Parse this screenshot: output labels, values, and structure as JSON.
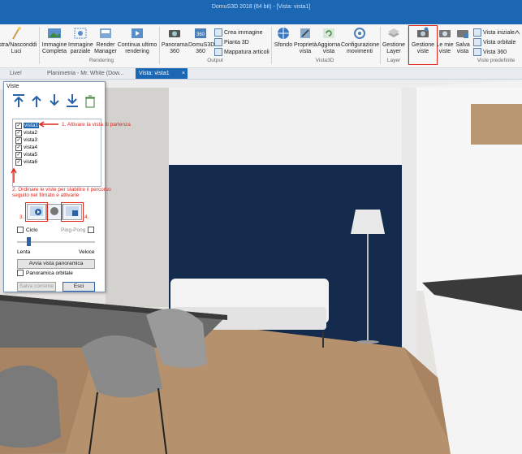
{
  "window": {
    "title": "DomuS3D 2018 (64 bit) - [Vista: vista1]"
  },
  "ribbon": {
    "buttons": [
      {
        "label": "ostra/Nasconddi\nLuci",
        "icon": "lights-icon"
      },
      {
        "label": "Immagine\nCompleta",
        "icon": "full-image-icon"
      },
      {
        "label": "Immagine\nparziale",
        "icon": "partial-image-icon"
      },
      {
        "label": "Render\nManager",
        "icon": "render-manager-icon"
      },
      {
        "label": "Continua ultimo\nrendering",
        "icon": "continue-render-icon"
      },
      {
        "label": "Panorama\n360",
        "icon": "panorama-icon"
      },
      {
        "label": "DomuS3D\n360",
        "icon": "domus-360-icon"
      },
      {
        "label": "Sfondo",
        "icon": "background-icon"
      },
      {
        "label": "Proprietà\nvista",
        "icon": "view-properties-icon"
      },
      {
        "label": "Aggiorna\nvista",
        "icon": "refresh-view-icon"
      },
      {
        "label": "Configurazione\nmovimenti",
        "icon": "movement-config-icon"
      },
      {
        "label": "Gestione\nLayer",
        "icon": "layer-icon"
      },
      {
        "label": "Gestione\nviste",
        "icon": "manage-views-icon"
      },
      {
        "label": "Le mie\nviste",
        "icon": "my-views-icon"
      },
      {
        "label": "Salva\nvista",
        "icon": "save-view-icon"
      }
    ],
    "small_items": [
      "Crea immagine",
      "Pianta 3D",
      "Mappatura articoli",
      "Vista iniziale",
      "Vista orbitale",
      "Vista 360"
    ],
    "groups": [
      "Rendering",
      "Output",
      "Vista3D",
      "Layer",
      "Viste predefinite"
    ]
  },
  "tabs": [
    "Live!",
    "Planimetria - Mr. White (Dow...",
    "Vista: vista1"
  ],
  "panel": {
    "title": "Viste",
    "views": [
      "vista1",
      "vista2",
      "vista3",
      "vista4",
      "vista5",
      "vista6"
    ],
    "annotations": {
      "a1": "1. Attivare la vista di partenza",
      "a2": "2. Ordinare le viste per stabilire il percorso seguito nel filmato e attivarle",
      "a3": "3.",
      "a4": "4."
    },
    "ciclo_label": "Ciclo",
    "pingpong_label": "Ping-Pong",
    "slow_label": "Lenta",
    "fast_label": "Veloce",
    "start_button": "Avvia vista panoramica",
    "orbital_label": "Panoramica orbitale",
    "save_button": "Salva corrente",
    "exit_button": "Esci"
  }
}
